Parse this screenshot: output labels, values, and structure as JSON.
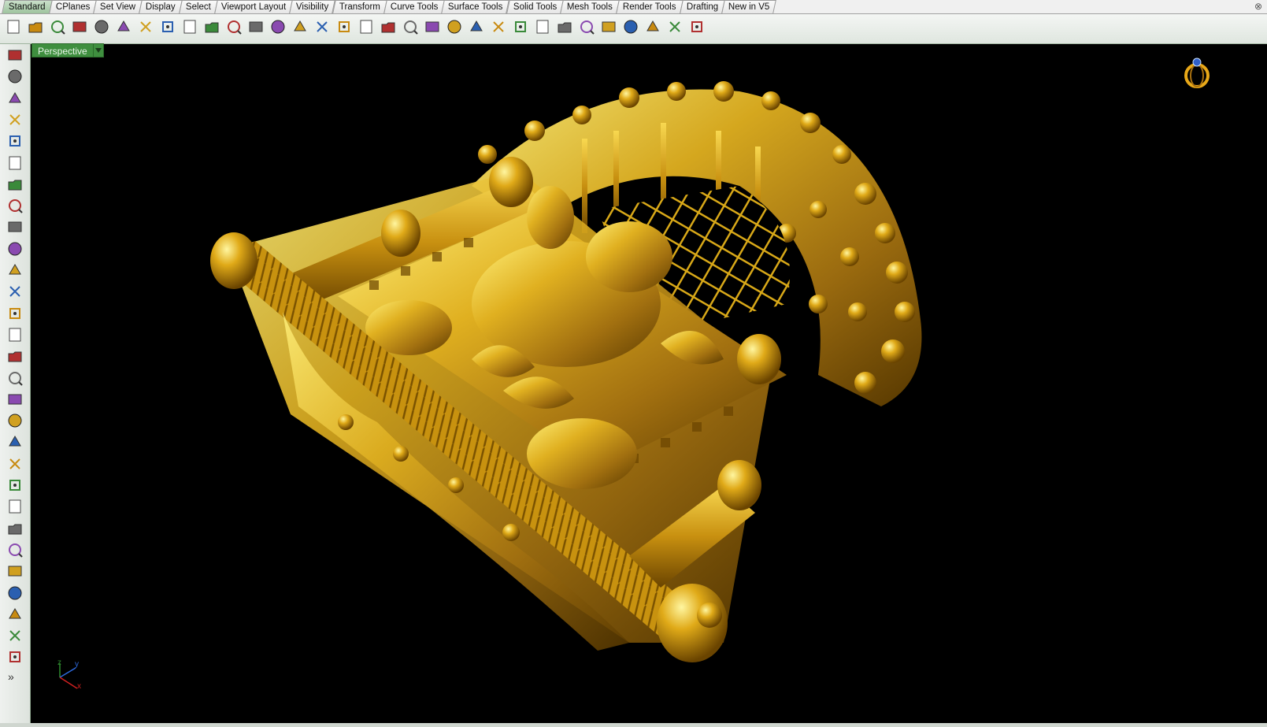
{
  "tabs": [
    {
      "label": "Standard",
      "active": true
    },
    {
      "label": "CPlanes"
    },
    {
      "label": "Set View"
    },
    {
      "label": "Display"
    },
    {
      "label": "Select"
    },
    {
      "label": "Viewport Layout"
    },
    {
      "label": "Visibility"
    },
    {
      "label": "Transform"
    },
    {
      "label": "Curve Tools"
    },
    {
      "label": "Surface Tools"
    },
    {
      "label": "Solid Tools"
    },
    {
      "label": "Mesh Tools"
    },
    {
      "label": "Render Tools"
    },
    {
      "label": "Drafting"
    },
    {
      "label": "New in V5"
    }
  ],
  "toolbar_icons": [
    "new-file-icon",
    "open-folder-icon",
    "save-icon",
    "print-icon",
    "import-icon",
    "cut-icon",
    "copy-icon",
    "paste-icon",
    "undo-icon",
    "pan-hand-icon",
    "rotate-view-icon",
    "zoom-window-icon",
    "zoom-dynamic-icon",
    "zoom-extents-icon",
    "zoom-selected-icon",
    "rotate-camera-icon",
    "four-viewports-icon",
    "car-render-icon",
    "shaded-icon",
    "circle-target-icon",
    "snap-grid-icon",
    "lightbulb-icon",
    "lock-icon",
    "shield-layer-icon",
    "color-wheel-icon",
    "sphere-material-icon",
    "render-sphere-icon",
    "blue-sphere-icon",
    "flag-icon",
    "gear-options-icon",
    "dimension-icon",
    "help-icon"
  ],
  "left_icons": [
    "select-arrow-icon",
    "point-icon",
    "polyline-icon",
    "curve-control-icon",
    "circle-icon",
    "ellipse-icon",
    "polygon-icon",
    "rectangle-icon",
    "arc-icon",
    "fillet-curve-icon",
    "surface-corner-icon",
    "extrude-surface-icon",
    "box-solid-icon",
    "boolean-union-icon",
    "cylinder-icon",
    "mesh-plane-icon",
    "gear-solid-icon",
    "move-arrow-icon",
    "trim-icon",
    "split-icon",
    "group-icon",
    "ungroup-icon",
    "curve-offset-icon",
    "curve-blend-icon",
    "text-icon",
    "scale-icon",
    "array-icon",
    "edit-points-icon",
    "cube-view-icon"
  ],
  "viewport": {
    "label": "Perspective"
  },
  "axis": {
    "x": "x",
    "y": "y",
    "z": "z"
  },
  "colors": {
    "viewport_bg": "#000000",
    "gold": "#d4a017",
    "active_tab": "#a8cca8",
    "viewport_label": "#3f8f3f"
  }
}
